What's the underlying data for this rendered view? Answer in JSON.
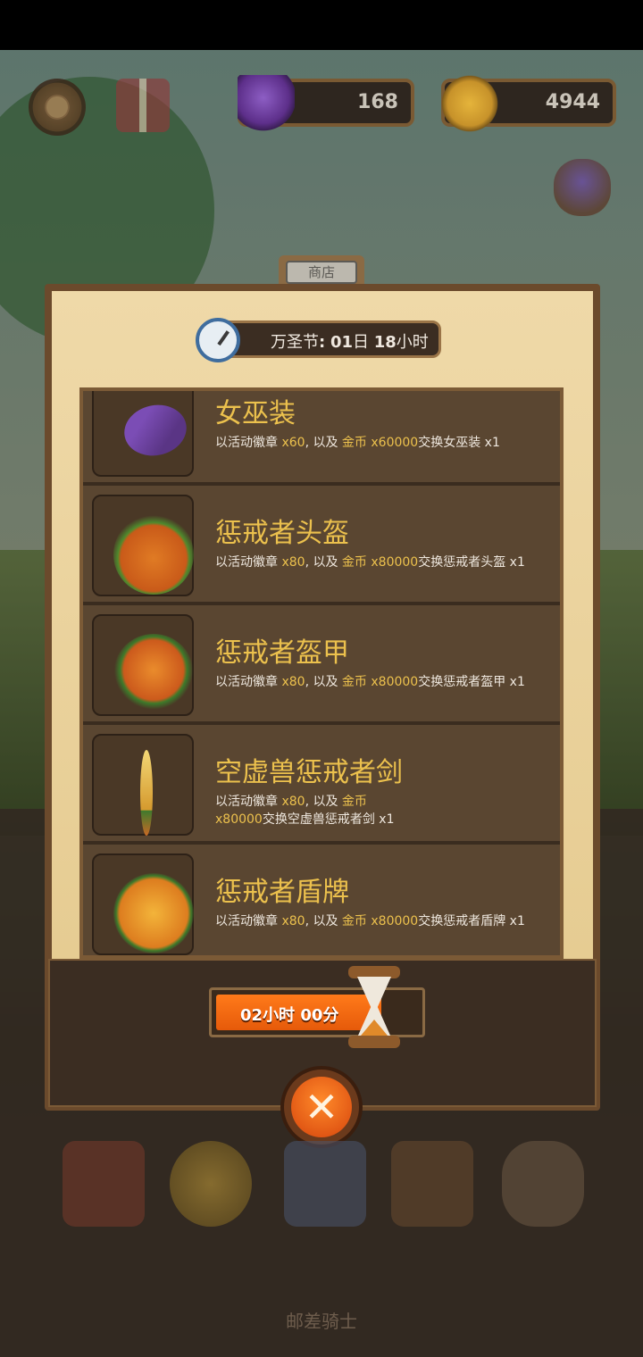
{
  "hud": {
    "gems": "168",
    "coins": "4944"
  },
  "modal": {
    "tab_label": "商店",
    "event_label": "万圣节",
    "event_sep": ":",
    "event_days": "01",
    "days_unit": "日",
    "event_hours": "18",
    "hours_unit": "小时"
  },
  "items": [
    {
      "name": "女巫装",
      "desc_prefix": "以活动徽章 ",
      "badge_qty": "x60",
      "desc_mid": ", 以及 ",
      "coin_label": "金币 x60000",
      "desc_suffix": "交换女巫装 x1",
      "icon": "witch-outfit-icon"
    },
    {
      "name": "惩戒者头盔",
      "desc_prefix": "以活动徽章 ",
      "badge_qty": "x80",
      "desc_mid": ", 以及 ",
      "coin_label": "金币 x80000",
      "desc_suffix": "交换惩戒者头盔 x1",
      "icon": "pumpkin-helmet-icon"
    },
    {
      "name": "惩戒者盔甲",
      "desc_prefix": "以活动徽章 ",
      "badge_qty": "x80",
      "desc_mid": ", 以及 ",
      "coin_label": "金币 x80000",
      "desc_suffix": "交换惩戒者盔甲 x1",
      "icon": "pumpkin-armor-icon"
    },
    {
      "name": "空虚兽惩戒者剑",
      "desc_prefix": "以活动徽章 ",
      "badge_qty": "x80",
      "desc_mid": ", 以及 ",
      "coin_label": "金币 x80000",
      "desc_suffix": "交换空虚兽惩戒者剑 x1",
      "icon": "flame-sword-icon"
    },
    {
      "name": "惩戒者盾牌",
      "desc_prefix": "以活动徽章 ",
      "badge_qty": "x80",
      "desc_mid": ", 以及 ",
      "coin_label": "金币 x80000",
      "desc_suffix": "交换惩戒者盾牌 x1",
      "icon": "pumpkin-shield-icon"
    }
  ],
  "refresh": {
    "hours": "02",
    "hours_unit": "小时",
    "minutes": "00",
    "minutes_unit": "分",
    "progress": 0.82
  },
  "footer": {
    "title": "邮差骑士"
  },
  "colors": {
    "accent_gold": "#ecc14d",
    "panel_brown": "#5a4631",
    "button_orange": "#e65a0a"
  }
}
